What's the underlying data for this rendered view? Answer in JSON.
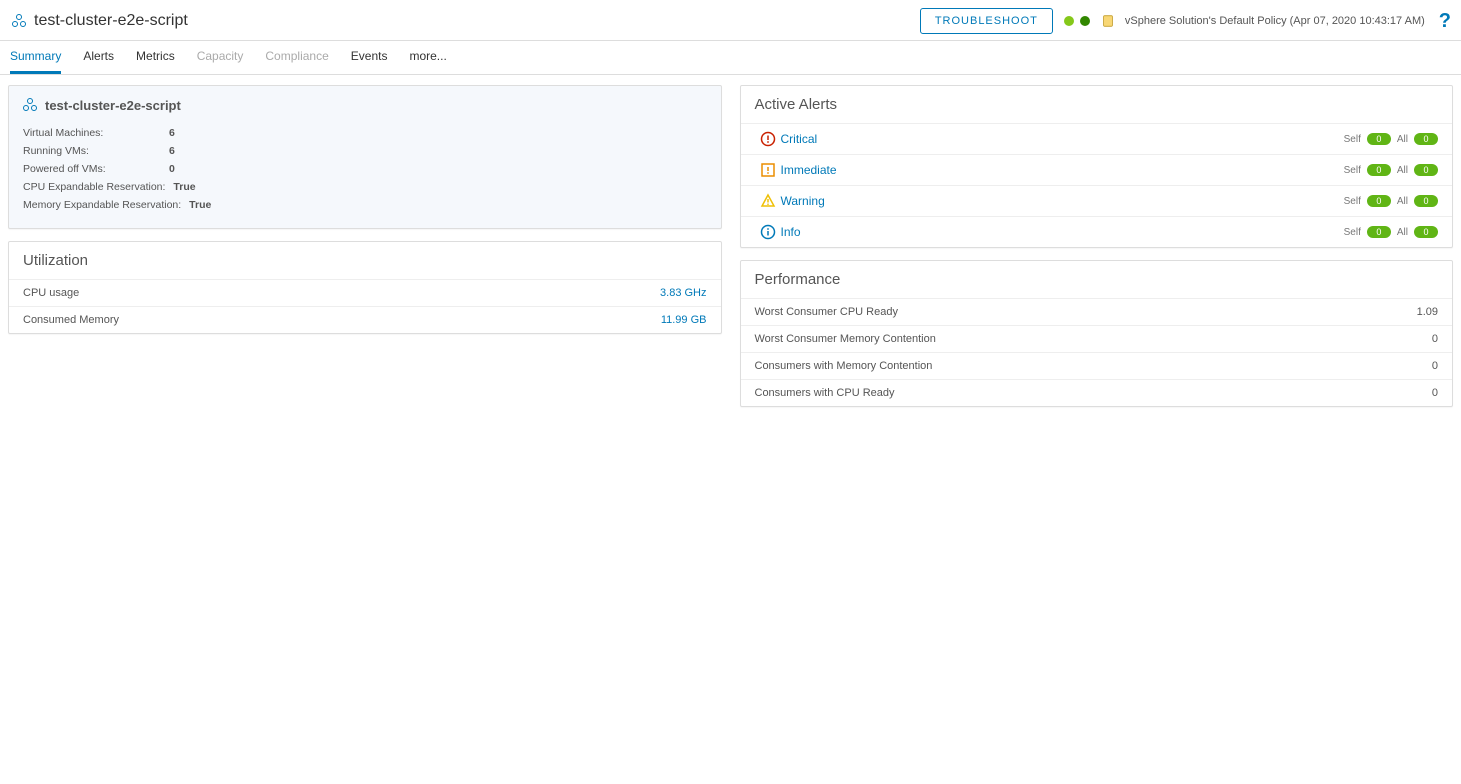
{
  "header": {
    "title": "test-cluster-e2e-script",
    "troubleshoot_label": "TROUBLESHOOT",
    "policy_text": "vSphere Solution's Default Policy (Apr 07, 2020 10:43:17 AM)",
    "help": "?"
  },
  "tabs": {
    "summary": "Summary",
    "alerts": "Alerts",
    "metrics": "Metrics",
    "capacity": "Capacity",
    "compliance": "Compliance",
    "events": "Events",
    "more": "more..."
  },
  "info_panel": {
    "title": "test-cluster-e2e-script",
    "stats": [
      {
        "label": "Virtual Machines:",
        "value": "6"
      },
      {
        "label": "Running VMs:",
        "value": "6"
      },
      {
        "label": "Powered off VMs:",
        "value": "0"
      },
      {
        "label": "CPU Expandable Reservation:",
        "value": "True"
      },
      {
        "label": "Memory Expandable Reservation:",
        "value": "True"
      }
    ]
  },
  "utilization": {
    "title": "Utilization",
    "rows": [
      {
        "label": "CPU usage",
        "value": "3.83 GHz"
      },
      {
        "label": "Consumed Memory",
        "value": "11.99 GB"
      }
    ]
  },
  "active_alerts": {
    "title": "Active Alerts",
    "self_label": "Self",
    "all_label": "All",
    "rows": [
      {
        "label": "Critical",
        "self": "0",
        "all": "0"
      },
      {
        "label": "Immediate",
        "self": "0",
        "all": "0"
      },
      {
        "label": "Warning",
        "self": "0",
        "all": "0"
      },
      {
        "label": "Info",
        "self": "0",
        "all": "0"
      }
    ]
  },
  "performance": {
    "title": "Performance",
    "rows": [
      {
        "label": "Worst Consumer CPU Ready",
        "value": "1.09"
      },
      {
        "label": "Worst Consumer Memory Contention",
        "value": "0"
      },
      {
        "label": "Consumers with Memory Contention",
        "value": "0"
      },
      {
        "label": "Consumers with CPU Ready",
        "value": "0"
      }
    ]
  }
}
